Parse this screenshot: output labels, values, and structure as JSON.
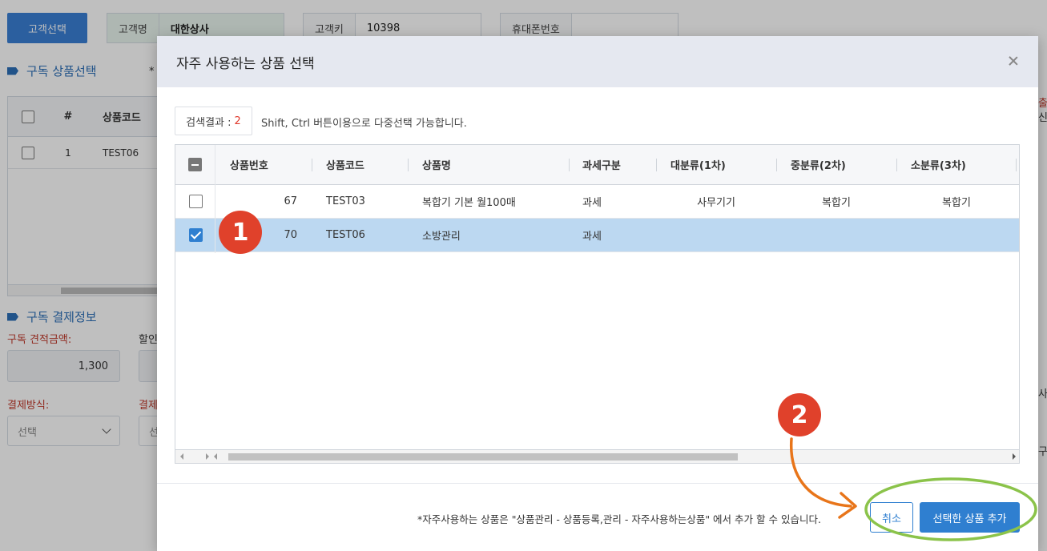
{
  "background": {
    "select_customer_button": "고객선택",
    "customer_name_label": "고객명",
    "customer_name_value": "대한상사",
    "customer_key_label": "고객키",
    "customer_key_value": "10398",
    "phone_label": "휴대폰번호",
    "section_products": "구독 상품선택",
    "section_products_mark": "*",
    "grid_header_number": "#",
    "grid_header_code": "상품코드",
    "grid_row_number": "1",
    "grid_row_code": "TEST06",
    "section_payment": "구독 결제정보",
    "estimate_label": "구독 견적금액:",
    "estimate_value": "1,300",
    "discount_label_partial": "할인",
    "payment_method_label": "결제방식:",
    "payment_method_value": "선택",
    "payment_label_partial": "결제",
    "payment_select_partial": "선",
    "right_edge_1": "출",
    "right_edge_2": "신",
    "right_edge_3": "사",
    "right_edge_4": "구"
  },
  "modal": {
    "title": "자주 사용하는 상품 선택",
    "result_label": "검색결과 :",
    "result_count": "2",
    "hint": "Shift, Ctrl 버튼이용으로 다중선택 가능합니다.",
    "columns": {
      "product_no": "상품번호",
      "product_code": "상품코드",
      "product_name": "상품명",
      "tax_type": "과세구분",
      "category_1": "대분류(1차)",
      "category_2": "중분류(2차)",
      "category_3": "소분류(3차)"
    },
    "rows": [
      {
        "product_no": "67",
        "product_code": "TEST03",
        "product_name": "복합기 기본 월100매",
        "tax_type": "과세",
        "category_1": "사무기기",
        "category_2": "복합기",
        "category_3": "복합기",
        "checked": false
      },
      {
        "product_no": "70",
        "product_code": "TEST06",
        "product_name": "소방관리",
        "tax_type": "과세",
        "category_1": "",
        "category_2": "",
        "category_3": "",
        "checked": true
      }
    ],
    "footer_note": "*자주사용하는 상품은 \"상품관리 - 상품등록,관리 - 자주사용하는상품\" 에서 추가 할 수 있습니다.",
    "cancel_button": "취소",
    "add_button": "선택한 상품 추가"
  },
  "annotations": {
    "step1": "1",
    "step2": "2",
    "badge_color": "#e0412b",
    "arrow_color": "#e8751a",
    "highlight_color": "#8bc34a"
  },
  "colors": {
    "primary": "#2f7fd0",
    "selected_row": "#bcd8f1",
    "header_bg": "#e5e8f0"
  }
}
